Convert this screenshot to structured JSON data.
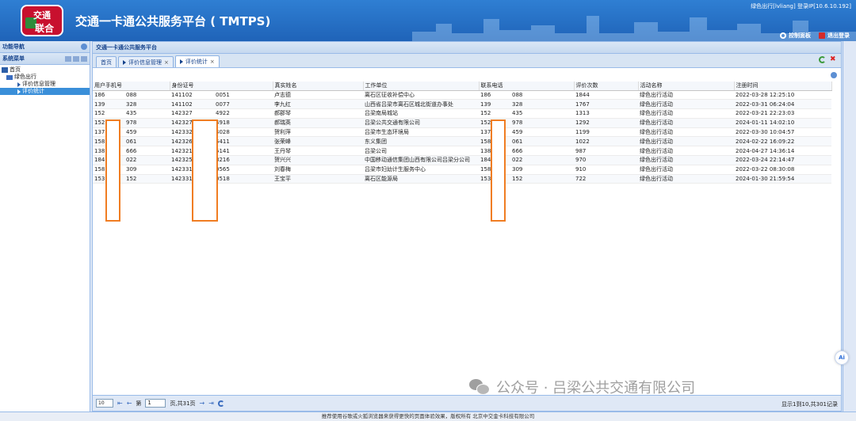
{
  "header": {
    "logo_line1": "交通",
    "logo_line2": "联合",
    "title": "交通一卡通公共服务平台 ( TMTPS)",
    "user_info": "绿色出行[lvliang]  登录IP[10.6.10.192]",
    "control_panel": "控制面板",
    "logout": "退出登录"
  },
  "left_panel": {
    "nav_title": "功能导航",
    "menu_title": "系统菜单",
    "tree": {
      "home": "首页",
      "group": "绿色出行",
      "items": [
        "评价信息管理",
        "评价统计"
      ]
    }
  },
  "main": {
    "panel_title": "交通一卡通公共服务平台",
    "tabs": [
      {
        "label": "首页",
        "active": false
      },
      {
        "label": "评价信息管理",
        "active": false
      },
      {
        "label": "评价统计",
        "active": true
      }
    ],
    "table": {
      "columns": [
        "用户手机号",
        "身份证号",
        "真实姓名",
        "工作单位",
        "联系电话",
        "评价次数",
        "活动名称",
        "注册时间"
      ],
      "rows": [
        [
          "186",
          "088",
          "141102",
          "0051",
          "卢志德",
          "离石区征收补偿中心",
          "186",
          "088",
          "1844",
          "绿色出行活动",
          "2022-03-28 12:25:10"
        ],
        [
          "139",
          "328",
          "141102",
          "0077",
          "李九红",
          "山西省吕梁市离石区城北街道办事处",
          "139",
          "328",
          "1767",
          "绿色出行活动",
          "2022-03-31 06:24:04"
        ],
        [
          "152",
          "435",
          "142327",
          "4922",
          "郝郡琴",
          "吕梁南局城站",
          "152",
          "435",
          "1313",
          "绿色出行活动",
          "2022-03-21 22:23:03"
        ],
        [
          "152",
          "978",
          "142327",
          "4918",
          "郝瑞英",
          "吕梁公共交通有限公司",
          "152",
          "978",
          "1292",
          "绿色出行活动",
          "2024-01-11 14:02:10"
        ],
        [
          "137",
          "459",
          "142332",
          "4028",
          "贺利萍",
          "吕梁市生态环境局",
          "137",
          "459",
          "1199",
          "绿色出行活动",
          "2022-03-30 10:04:57"
        ],
        [
          "158",
          "061",
          "142326",
          "5411",
          "张荣峰",
          "东义集团",
          "158",
          "061",
          "1022",
          "绿色出行活动",
          "2024-02-22 16:09:22"
        ],
        [
          "138",
          "666",
          "142321",
          "5141",
          "王丹琴",
          "吕梁公司",
          "138",
          "666",
          "987",
          "绿色出行活动",
          "2024-04-27 14:36:14"
        ],
        [
          "184",
          "022",
          "142325",
          "8216",
          "贺兴兴",
          "中国移动通信集团山西有限公司吕梁分公司",
          "184",
          "022",
          "970",
          "绿色出行活动",
          "2022-03-24 22:14:47"
        ],
        [
          "158",
          "309",
          "142331",
          "0565",
          "刘春梅",
          "吕梁市妇幼计生服务中心",
          "158",
          "309",
          "910",
          "绿色出行活动",
          "2022-03-22 08:30:08"
        ],
        [
          "153",
          "152",
          "142331",
          "0518",
          "王宝平",
          "离石区能源局",
          "153",
          "152",
          "722",
          "绿色出行活动",
          "2024-01-30 21:59:54"
        ]
      ]
    },
    "pager": {
      "page_size": "10",
      "page_label": "第",
      "current_page": "1",
      "total_pages_text": "页,共31页",
      "summary": "显示1到10,共301记录"
    }
  },
  "footer": "推荐使用谷歌或火狐浏览器来获得更快的页面体验效果，版权所有 北京中交金卡科技有限公司",
  "watermark": "公众号 · 吕梁公共交通有限公司",
  "ai_badge": "Ai",
  "colors": {
    "header_blue": "#1f63b8",
    "mask_orange": "#f07d22",
    "selected_blue": "#3a8fd9"
  }
}
